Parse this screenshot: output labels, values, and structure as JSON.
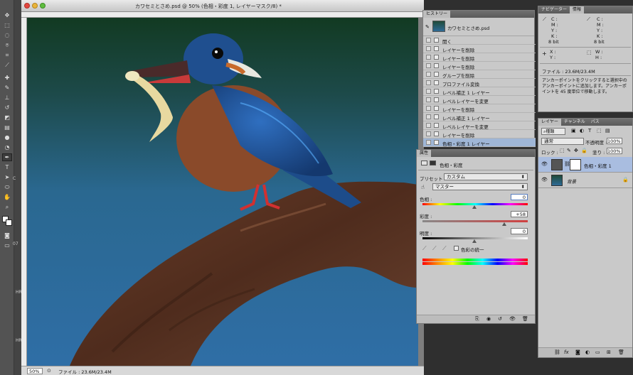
{
  "document": {
    "title": "カワセミとさめ.psd @ 50% (色相・彩度 1, レイヤーマスク/8) *",
    "zoom": "50%",
    "status": "ファイル : 23.6M/23.4M"
  },
  "toolbar": {
    "tools": [
      "move",
      "marquee",
      "lasso",
      "quick-select",
      "crop",
      "eyedropper",
      "healing",
      "brush",
      "stamp",
      "history-brush",
      "eraser",
      "gradient",
      "blur",
      "dodge",
      "pen",
      "type",
      "path-select",
      "shape",
      "hand",
      "zoom"
    ],
    "side_labels": [
      "C",
      "07",
      "HRO",
      "HRO8"
    ]
  },
  "history": {
    "tab": "ヒストリー",
    "snapshot": "カワセミとさめ.psd",
    "items": [
      "開く",
      "レイヤーを削除",
      "レイヤーを削除",
      "レイヤーを削除",
      "グループを削除",
      "プロファイル変換",
      "レベル補正 1 レイヤー",
      "レベルレイヤーを変更",
      "レイヤーを削除",
      "レベル補正 1 レイヤー",
      "レベルレイヤーを変更",
      "レイヤーを削除",
      "色相・彩度 1 レイヤー"
    ]
  },
  "navigator": {
    "tabs": [
      "ナビゲーター",
      "情報"
    ],
    "c": "C :",
    "m": "M :",
    "y": "Y :",
    "k": "K :",
    "bit": "8 bit",
    "x": "X :",
    "yy": "Y :",
    "w": "W :",
    "h": "H :",
    "file": "ファイル : 23.6M/23.4M",
    "hint": "アンカーポイントをクリックすると選択中のアンカーポイントに追加します。アンカーポイントを 45 度単位で移動します。"
  },
  "properties": {
    "tab": "属性",
    "kind": "色相・彩度",
    "preset_label": "プリセット :",
    "preset_value": "カスタム",
    "channel": "マスター",
    "hue_label": "色相 :",
    "hue_value": "0",
    "sat_label": "彩度 :",
    "sat_value": "+58",
    "light_label": "明度 :",
    "light_value": "0",
    "colorize_label": "色彩の統一"
  },
  "layers": {
    "tabs": [
      "レイヤー",
      "チャンネル",
      "パス"
    ],
    "kind": "種類",
    "blend": "通常",
    "opacity_label": "不透明度 :",
    "opacity_value": "100%",
    "lock_label": "ロック :",
    "fill_label": "塗り :",
    "fill_value": "100%",
    "items": [
      {
        "name": "色相・彩度 1",
        "selected": true
      },
      {
        "name": "背景",
        "selected": false
      }
    ]
  }
}
